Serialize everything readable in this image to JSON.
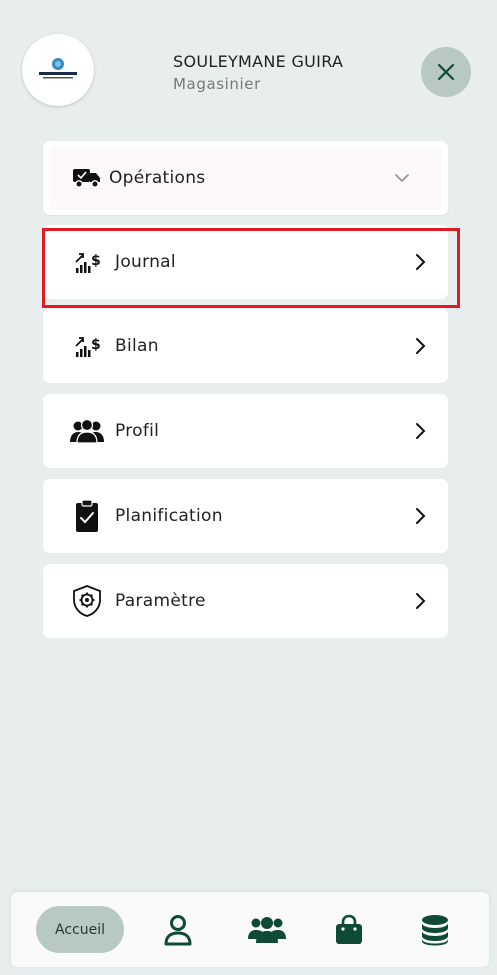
{
  "header": {
    "user_name": "SOULEYMANE GUIRA",
    "user_role": "Magasinier"
  },
  "menu": {
    "items": [
      {
        "label": "Opérations",
        "icon": "delivery-truck-icon",
        "trailing": "chevron-down-icon"
      },
      {
        "label": "Journal",
        "icon": "chart-dollar-icon",
        "trailing": "chevron-right-icon"
      },
      {
        "label": "Bilan",
        "icon": "chart-dollar-icon",
        "trailing": "chevron-right-icon"
      },
      {
        "label": "Profil",
        "icon": "users-group-icon",
        "trailing": "chevron-right-icon"
      },
      {
        "label": "Planification",
        "icon": "clipboard-check-icon",
        "trailing": "chevron-right-icon"
      },
      {
        "label": "Paramètre",
        "icon": "shield-gear-icon",
        "trailing": "chevron-right-icon"
      }
    ]
  },
  "bottom_nav": {
    "home_label": "Accueil",
    "icons": [
      "user-icon",
      "users-group-icon",
      "shopping-bag-icon",
      "database-icon"
    ]
  },
  "colors": {
    "background": "#e8eeee",
    "accent": "#0f4a36",
    "pill": "#b8c9c3",
    "highlight": "#e01b24"
  }
}
